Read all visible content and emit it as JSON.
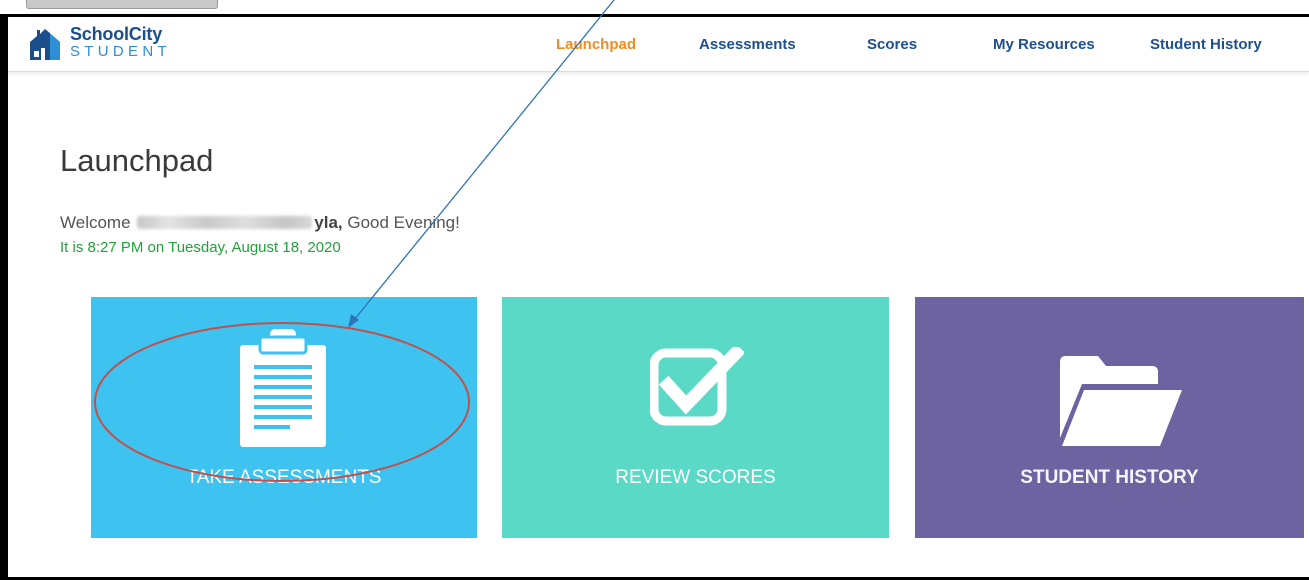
{
  "app": {
    "logo_line1": "SchoolCity",
    "logo_line2": "STUDENT"
  },
  "nav": [
    {
      "label": "Launchpad",
      "active": true
    },
    {
      "label": "Assessments",
      "active": false
    },
    {
      "label": "Scores",
      "active": false
    },
    {
      "label": "My Resources",
      "active": false
    },
    {
      "label": "Student History",
      "active": false
    }
  ],
  "page": {
    "title": "Launchpad",
    "welcome_prefix": "Welcome",
    "welcome_name_visible": "yla,",
    "welcome_suffix": "Good Evening!",
    "time_line": "It is 8:27 PM on Tuesday, August 18, 2020"
  },
  "tiles": [
    {
      "label": "TAKE ASSESSMENTS",
      "icon": "clipboard-icon",
      "color": "#3ec3f0"
    },
    {
      "label": "REVIEW SCORES",
      "icon": "checkbox-icon",
      "color": "#5ad9c6"
    },
    {
      "label": "STUDENT HISTORY",
      "icon": "folder-icon",
      "color": "#6c63a0"
    }
  ],
  "colors": {
    "nav_active": "#f28b22",
    "nav_default": "#1f4f8c",
    "time_text": "#23a13c",
    "annotation_ellipse": "#c0504d",
    "annotation_arrow": "#2e75b6"
  }
}
